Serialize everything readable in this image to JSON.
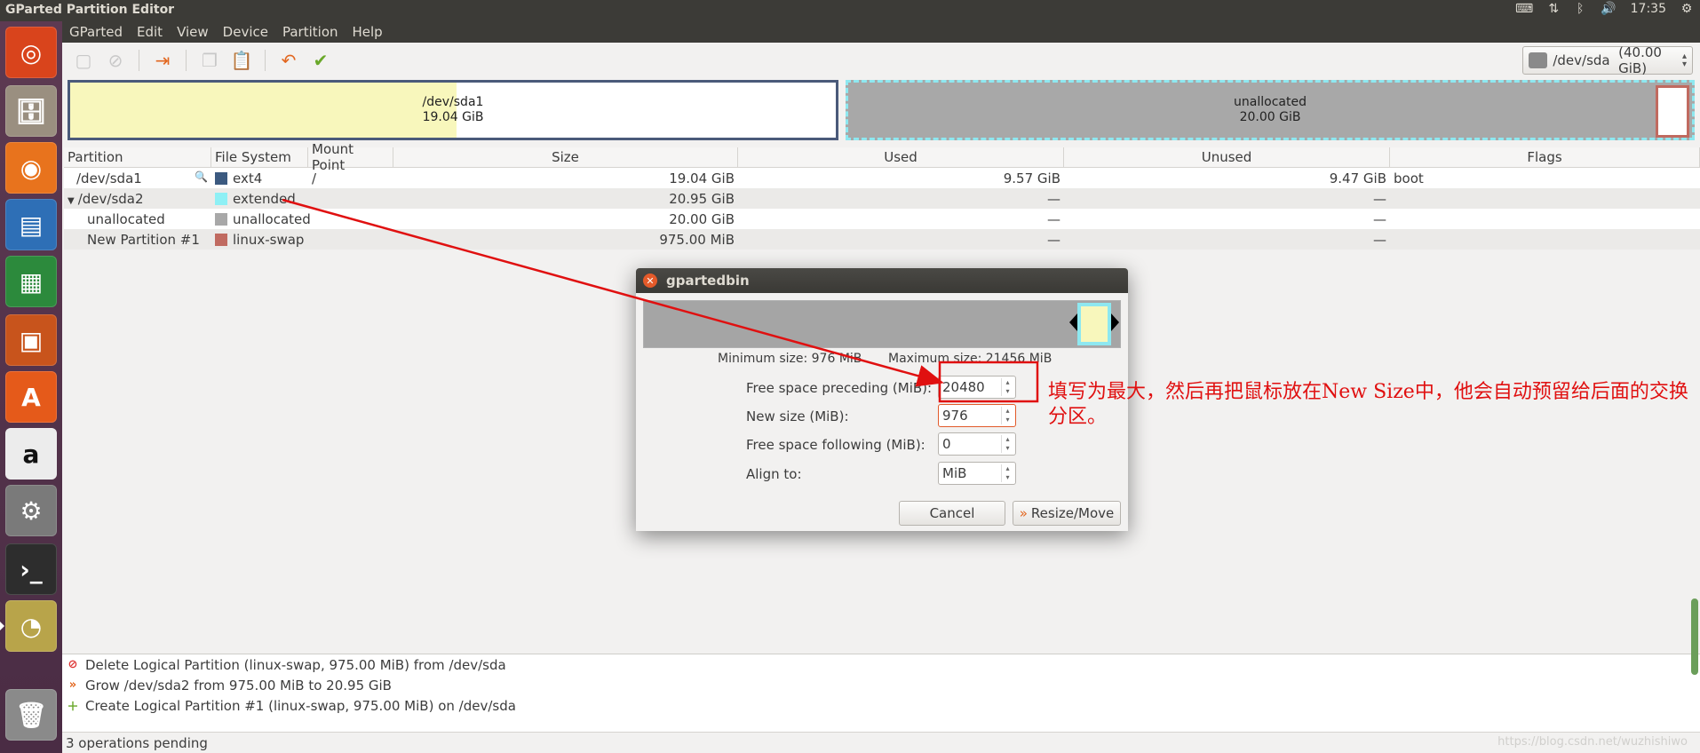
{
  "top_panel": {
    "window_title": "GParted Partition Editor",
    "time": "17:35",
    "icons": [
      "keyboard-icon",
      "network-icon",
      "bluetooth-icon",
      "volume-icon",
      "power-gear-icon"
    ]
  },
  "launcher": {
    "items": [
      {
        "name": "ubuntu-logo-icon",
        "glyph": "◎",
        "color": "#d9441c"
      },
      {
        "name": "files-icon",
        "glyph": "🗄",
        "color": "#9a8f80"
      },
      {
        "name": "firefox-icon",
        "glyph": "◉",
        "color": "#e8731d"
      },
      {
        "name": "writer-icon",
        "glyph": "▤",
        "color": "#2e6fb6"
      },
      {
        "name": "calc-icon",
        "glyph": "▦",
        "color": "#2c8a3c"
      },
      {
        "name": "impress-icon",
        "glyph": "▣",
        "color": "#c8541c"
      },
      {
        "name": "software-center-icon",
        "glyph": "A",
        "color": "#e55a1a"
      },
      {
        "name": "amazon-icon",
        "glyph": "a",
        "color": "#ececec"
      },
      {
        "name": "system-settings-icon",
        "glyph": "⚙",
        "color": "#7a7a7a"
      },
      {
        "name": "terminal-icon",
        "glyph": "›_",
        "color": "#2d2d2d"
      },
      {
        "name": "gparted-icon",
        "glyph": "◔",
        "color": "#b8a44a"
      },
      {
        "name": "trash-icon",
        "glyph": "🗑",
        "color": "#8a8a8a"
      }
    ]
  },
  "menubar": [
    "GParted",
    "Edit",
    "View",
    "Device",
    "Partition",
    "Help"
  ],
  "device": {
    "path": "/dev/sda",
    "size": "(40.00 GiB)"
  },
  "diskmap": {
    "sda1": {
      "name": "/dev/sda1",
      "size": "19.04 GiB"
    },
    "unallocated": {
      "name": "unallocated",
      "size": "20.00 GiB"
    }
  },
  "table": {
    "headers": [
      "Partition",
      "File System",
      "Mount Point",
      "Size",
      "Used",
      "Unused",
      "Flags"
    ],
    "rows": [
      {
        "partition": "/dev/sda1",
        "fs": "ext4",
        "fs_color": "#3c5a80",
        "mount": "/",
        "size": "19.04 GiB",
        "used": "9.57 GiB",
        "unused": "9.47 GiB",
        "flags": "boot"
      },
      {
        "partition": "/dev/sda2",
        "fs": "extended",
        "fs_color": "#8ef0f5",
        "mount": "",
        "size": "20.95 GiB",
        "used": "—",
        "unused": "—",
        "flags": ""
      },
      {
        "partition": "unallocated",
        "fs": "unallocated",
        "fs_color": "#a8a8a8",
        "mount": "",
        "size": "20.00 GiB",
        "used": "—",
        "unused": "—",
        "flags": ""
      },
      {
        "partition": "New Partition #1",
        "fs": "linux-swap",
        "fs_color": "#c06a60",
        "mount": "",
        "size": "975.00 MiB",
        "used": "—",
        "unused": "—",
        "flags": ""
      }
    ]
  },
  "operations": [
    "Delete Logical Partition (linux-swap, 975.00 MiB) from /dev/sda",
    "Grow /dev/sda2 from 975.00 MiB to 20.95 GiB",
    "Create Logical Partition #1 (linux-swap, 975.00 MiB) on /dev/sda"
  ],
  "status": "3 operations pending",
  "watermark": "https://blog.csdn.net/wuzhishiwo",
  "dialog": {
    "title": "gpartedbin",
    "min_size": "Minimum size: 976 MiB",
    "max_size": "Maximum size: 21456 MiB",
    "fields": [
      {
        "label": "Free space preceding (MiB):",
        "value": "20480"
      },
      {
        "label": "New size (MiB):",
        "value": "976"
      },
      {
        "label": "Free space following (MiB):",
        "value": "0"
      },
      {
        "label": "Align to:",
        "value": "MiB"
      }
    ],
    "cancel_label": "Cancel",
    "resize_label": "Resize/Move"
  },
  "annotation": {
    "text": "填写为最大，然后再把鼠标放在New Size中，他会自动预留给后面的交换分区。",
    "color": "#e01010"
  }
}
